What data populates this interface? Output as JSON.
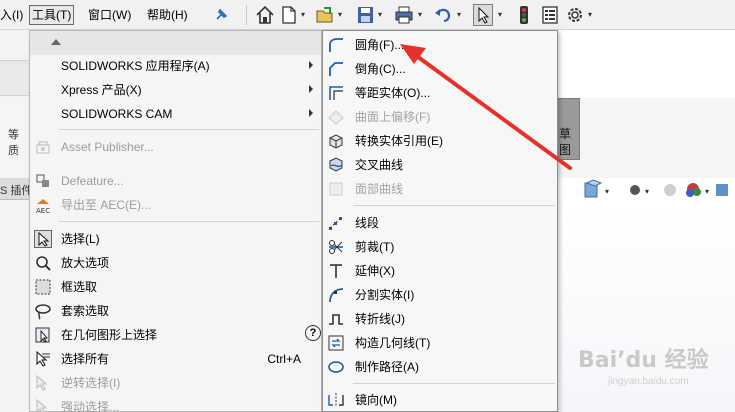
{
  "menubar": {
    "items": [
      {
        "label": "入(I)",
        "active": false
      },
      {
        "label": "工具(T)",
        "active": true
      },
      {
        "label": "窗口(W)",
        "active": false
      },
      {
        "label": "帮助(H)",
        "active": false
      }
    ],
    "toolbar_icons": [
      "home-icon",
      "new-file-icon",
      "open-file-icon",
      "save-icon",
      "print-icon",
      "undo-icon",
      "select-pointer-icon",
      "traffic-light-icon",
      "file-properties-icon",
      "options-gear-icon"
    ]
  },
  "background": {
    "left_tab_label": "S 插件",
    "left_side_fragment_1": "等",
    "left_side_fragment_2": "质",
    "right_button_line1": "草",
    "right_button_line2": "图"
  },
  "tools_menu": {
    "items": [
      {
        "label": "SOLIDWORKS 应用程序(A)",
        "submenu": true,
        "disabled": false,
        "icon": ""
      },
      {
        "label": "Xpress 产品(X)",
        "submenu": true,
        "disabled": false,
        "icon": ""
      },
      {
        "label": "SOLIDWORKS CAM",
        "submenu": true,
        "disabled": false,
        "icon": ""
      },
      {
        "label": "Asset Publisher...",
        "submenu": false,
        "disabled": true,
        "icon": "asset-publisher-icon"
      },
      {
        "label": "Defeature...",
        "submenu": false,
        "disabled": true,
        "icon": "defeature-icon"
      },
      {
        "label": "导出至 AEC(E)...",
        "submenu": false,
        "disabled": true,
        "icon": "export-aec-icon"
      },
      {
        "label": "选择(L)",
        "submenu": false,
        "disabled": false,
        "icon": "select-icon"
      },
      {
        "label": "放大选项",
        "submenu": false,
        "disabled": false,
        "icon": "magnify-select-icon"
      },
      {
        "label": "框选取",
        "submenu": false,
        "disabled": false,
        "icon": "box-select-icon"
      },
      {
        "label": "套索选取",
        "submenu": false,
        "disabled": false,
        "icon": "lasso-select-icon"
      },
      {
        "label": "在几何图形上选择",
        "submenu": false,
        "disabled": false,
        "icon": "select-over-geometry-icon",
        "help": "?"
      },
      {
        "label": "选择所有",
        "submenu": false,
        "disabled": false,
        "icon": "select-all-icon",
        "shortcut": "Ctrl+A"
      },
      {
        "label": "逆转选择(I)",
        "submenu": false,
        "disabled": true,
        "icon": "invert-selection-icon"
      },
      {
        "label": "强动选择...",
        "submenu": false,
        "disabled": true,
        "icon": "power-select-icon"
      }
    ]
  },
  "sketch_menu": {
    "items": [
      {
        "label": "圆角(F)...",
        "disabled": false,
        "icon": "fillet-icon"
      },
      {
        "label": "倒角(C)...",
        "disabled": false,
        "icon": "chamfer-icon"
      },
      {
        "label": "等距实体(O)...",
        "disabled": false,
        "icon": "offset-entities-icon"
      },
      {
        "label": "曲面上偏移(F)",
        "disabled": true,
        "icon": "offset-on-surface-icon"
      },
      {
        "label": "转换实体引用(E)",
        "disabled": false,
        "icon": "convert-entities-icon"
      },
      {
        "label": "交叉曲线",
        "disabled": false,
        "icon": "intersection-curve-icon"
      },
      {
        "label": "面部曲线",
        "disabled": true,
        "icon": "face-curves-icon"
      },
      {
        "label": "线段",
        "disabled": false,
        "icon": "segment-icon"
      },
      {
        "label": "剪裁(T)",
        "disabled": false,
        "icon": "trim-icon"
      },
      {
        "label": "延伸(X)",
        "disabled": false,
        "icon": "extend-icon"
      },
      {
        "label": "分割实体(I)",
        "disabled": false,
        "icon": "split-entities-icon"
      },
      {
        "label": "转折线(J)",
        "disabled": false,
        "icon": "jog-line-icon"
      },
      {
        "label": "构造几何线(T)",
        "disabled": false,
        "icon": "construction-geometry-icon"
      },
      {
        "label": "制作路径(A)",
        "disabled": false,
        "icon": "make-path-icon"
      },
      {
        "label": "镜向(M)",
        "disabled": false,
        "icon": "mirror-icon"
      }
    ]
  },
  "colors": {
    "annotation_arrow": "#e8302a",
    "accent_blue": "#1f5fa8"
  },
  "watermark": {
    "text": "Bai’du 经验",
    "sub": "jingyan.baidu.com"
  }
}
